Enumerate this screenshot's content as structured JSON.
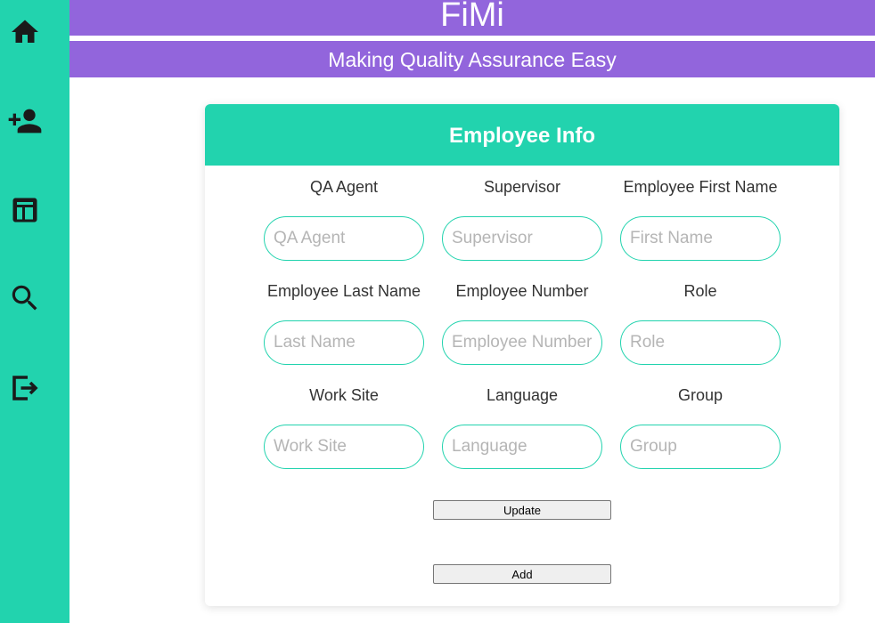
{
  "app": {
    "title": "FiMi",
    "subtitle": "Making Quality Assurance Easy"
  },
  "sidebar": {
    "items": [
      {
        "icon": "home-icon"
      },
      {
        "icon": "add-person-icon"
      },
      {
        "icon": "table-icon"
      },
      {
        "icon": "search-icon"
      },
      {
        "icon": "exit-icon"
      }
    ]
  },
  "form": {
    "title": "Employee Info",
    "fields": [
      {
        "label": "QA Agent",
        "placeholder": "QA Agent",
        "value": ""
      },
      {
        "label": "Supervisor",
        "placeholder": "Supervisor",
        "value": ""
      },
      {
        "label": "Employee First Name",
        "placeholder": "First Name",
        "value": ""
      },
      {
        "label": "Employee Last Name",
        "placeholder": "Last Name",
        "value": ""
      },
      {
        "label": "Employee Number",
        "placeholder": "Employee Number",
        "value": ""
      },
      {
        "label": "Role",
        "placeholder": "Role",
        "value": ""
      },
      {
        "label": "Work Site",
        "placeholder": "Work Site",
        "value": ""
      },
      {
        "label": "Language",
        "placeholder": "Language",
        "value": ""
      },
      {
        "label": "Group",
        "placeholder": "Group",
        "value": ""
      }
    ],
    "update_label": "Update",
    "add_label": "Add"
  },
  "colors": {
    "accent": "#22d3ae",
    "brand": "#9265dc",
    "icon": "#1a1a1a"
  }
}
